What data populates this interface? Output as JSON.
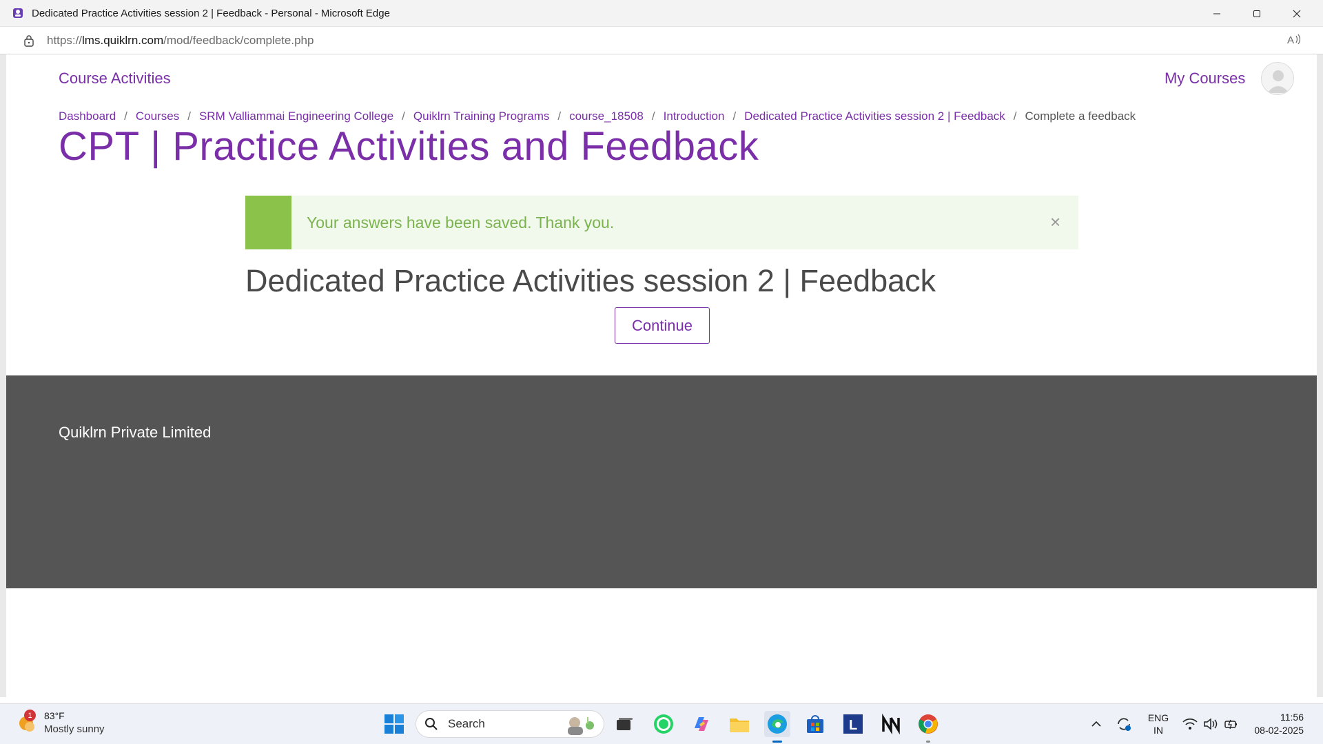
{
  "window": {
    "title": "Dedicated Practice Activities session 2 | Feedback - Personal - Microsoft Edge"
  },
  "address_bar": {
    "url_prefix": "https://",
    "url_host": "lms.quiklrn.com",
    "url_path": "/mod/feedback/complete.php"
  },
  "nav": {
    "course_activities": "Course Activities",
    "my_courses": "My Courses"
  },
  "breadcrumb": [
    "Dashboard",
    "Courses",
    "SRM Valliammai Engineering College",
    "Quiklrn Training Programs",
    "course_18508",
    "Introduction",
    "Dedicated Practice Activities session 2 | Feedback",
    "Complete a feedback"
  ],
  "breadcrumb_separator": "/",
  "page_title": "CPT | Practice Activities and Feedback",
  "alert": {
    "message": "Your answers have been saved. Thank you.",
    "close": "×",
    "color": "#8bc34a"
  },
  "activity_title": "Dedicated Practice Activities session 2 | Feedback",
  "continue_button": "Continue",
  "footer": {
    "company": "Quiklrn Private Limited"
  },
  "taskbar": {
    "weather_temp": "83°F",
    "weather_condition": "Mostly sunny",
    "weather_badge": "1",
    "search_label": "Search",
    "apps": [
      "start-icon",
      "search-icon",
      "task-view-icon",
      "whatsapp-icon",
      "copilot-icon",
      "file-explorer-icon",
      "edge-icon",
      "store-icon",
      "l-app-icon",
      "notion-icon",
      "chrome-icon"
    ],
    "language_line1": "ENG",
    "language_line2": "IN",
    "time": "11:56",
    "date": "08-02-2025"
  },
  "colors": {
    "brand": "#7a2ea8",
    "footer_bg": "#555555",
    "alert_bg": "#f1f8ec"
  }
}
